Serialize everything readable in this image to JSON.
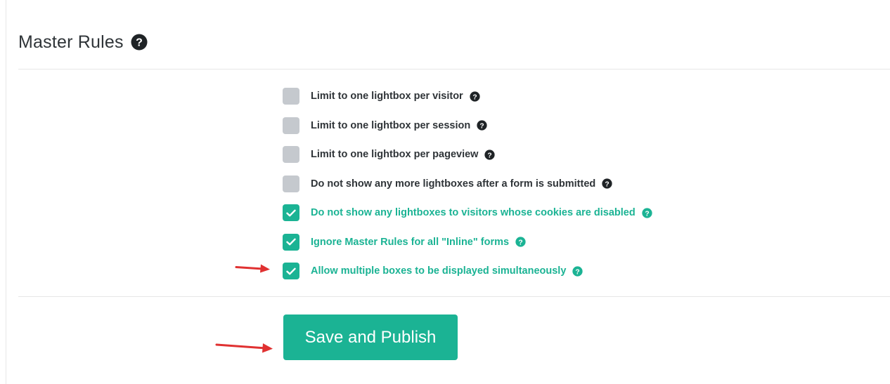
{
  "header": {
    "title": "Master Rules"
  },
  "rules": [
    {
      "label": "Limit to one lightbox per visitor",
      "checked": false
    },
    {
      "label": "Limit to one lightbox per session",
      "checked": false
    },
    {
      "label": "Limit to one lightbox per pageview",
      "checked": false
    },
    {
      "label": "Do not show any more lightboxes after a form is submitted",
      "checked": false
    },
    {
      "label": "Do not show any lightboxes to visitors whose cookies are disabled",
      "checked": true
    },
    {
      "label": "Ignore Master Rules for all \"Inline\" forms",
      "checked": true
    },
    {
      "label": "Allow multiple boxes to be displayed simultaneously",
      "checked": true
    }
  ],
  "actions": {
    "save_label": "Save and Publish"
  },
  "colors": {
    "accent": "#1bb394",
    "unchecked_box": "#c5c9ce",
    "text_dark": "#2f3438",
    "annotation_arrow": "#e03131"
  },
  "icons": {
    "help": "question-circle-icon",
    "check": "check-icon",
    "annotation": "red-arrow-icon"
  }
}
